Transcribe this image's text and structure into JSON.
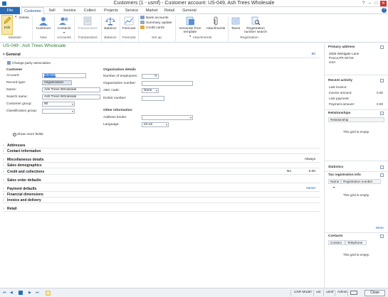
{
  "window": {
    "title": "Customers (1 - usmf) - Customer account: US-049, Ash Trees Wholesale"
  },
  "tabs": [
    "File",
    "Customer",
    "Sell",
    "Invoice",
    "Collect",
    "Projects",
    "Service",
    "Market",
    "Retail",
    "General"
  ],
  "ribbon": {
    "edit": "Edit",
    "delete": "Delete",
    "customer": "Customer",
    "contacts": "Contacts",
    "transactions": "Transactions",
    "balance": "Balance",
    "forecast": "Forecast",
    "bank_accounts": "Bank accounts",
    "summary_update": "Summary update",
    "credit_cards": "Credit cards",
    "generate_from_template": "Generate from template",
    "attachments": "Attachments",
    "taxes": "Taxes",
    "registration_number_search": "Registration number search",
    "groups": {
      "maintain": "Maintain",
      "new": "New",
      "accounts": "Accounts",
      "transactions": "Transactions",
      "balance": "Balance",
      "forecast": "Forecast",
      "set_up": "Set up",
      "attachments": "Attachments",
      "registration": "Registration"
    }
  },
  "page_title": "US-049 : Ash Trees Wholesale",
  "general": {
    "header": "General",
    "count": "80",
    "change_party": "Change party association",
    "customer_hdr": "Customer",
    "account_label": "Account:",
    "account_value": "US-049",
    "record_type_label": "Record type:",
    "record_type_value": "Organization",
    "name_label": "Name:",
    "name_value": "Ash Trees Wholesale",
    "search_name_label": "Search name:",
    "search_name_value": "Ash Trees Wholesale",
    "customer_group_label": "Customer group:",
    "customer_group_value": "80",
    "classification_group_label": "Classification group:",
    "org_details_hdr": "Organization details",
    "num_employees_label": "Number of employees:",
    "num_employees_value": "0",
    "org_number_label": "Organization number:",
    "abc_code_label": "ABC code:",
    "abc_code_value": "None",
    "duns_label": "DUNS number:",
    "other_info_hdr": "Other information",
    "address_books_label": "Address books:",
    "language_label": "Language:",
    "language_value": "en-us",
    "show_more": "Show more fields"
  },
  "sections": [
    {
      "label": "Addresses",
      "value": ""
    },
    {
      "label": "Contact information",
      "value": ""
    },
    {
      "label": "Miscellaneous details",
      "value": "Always"
    },
    {
      "label": "Sales demographics",
      "value": ""
    },
    {
      "label": "Credit and collections",
      "value": "No",
      "value2": "0.00"
    },
    {
      "label": "Sales order defaults",
      "value": ""
    },
    {
      "label": "Payment defaults",
      "value": "Net10"
    },
    {
      "label": "Financial dimensions",
      "value": ""
    },
    {
      "label": "Invoice and delivery",
      "value": ""
    },
    {
      "label": "Retail",
      "value": ""
    }
  ],
  "right": {
    "primary_address_hdr": "Primary address",
    "address_lines": [
      "2055 Westgate Lane",
      "Ponce,PR 00716",
      "USA"
    ],
    "recent_activity_hdr": "Recent activity",
    "last_invoice": "Last invoice:",
    "invoice_amount": "Invoice amount:",
    "invoice_amount_value": "0.00",
    "last_payment": "Last payment:",
    "payment_amount": "Payment amount:",
    "payment_amount_value": "0.00",
    "relationships_hdr": "Relationships",
    "relationship_col": "Relationship",
    "grid_empty": "This grid is empty.",
    "statistics_hdr": "Statistics",
    "tax_reg_hdr": "Tax registration info",
    "name_col": "Name",
    "reg_number_col": "Registration number",
    "more": "More",
    "contacts_hdr": "Contacts",
    "contact_col": "Contact",
    "telephone_col": "Telephone"
  },
  "status": {
    "model": "USR Model",
    "user": "usr",
    "company": "usmf",
    "role": "Admin",
    "close": "Close"
  },
  "colors": {
    "accent": "#2b6db5",
    "title_green": "#2e7d32",
    "link": "#1a5fb4"
  }
}
